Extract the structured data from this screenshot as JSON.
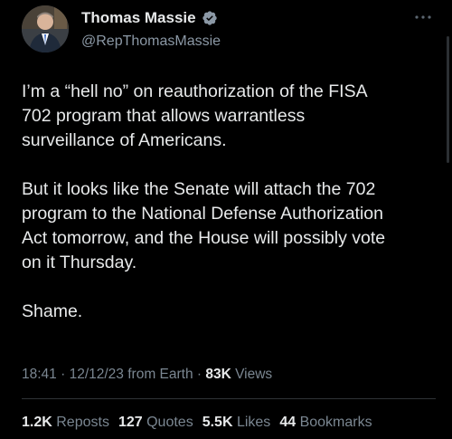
{
  "author": {
    "display_name": "Thomas Massie",
    "handle": "@RepThomasMassie",
    "verified_color": "#8b98a5",
    "avatar_icon": "portrait-avatar"
  },
  "tweet": {
    "paragraphs": [
      "I’m a “hell no” on reauthorization of the FISA\n702 program that allows warrantless\nsurveillance of Americans.",
      "But it looks like the Senate will attach the 702\nprogram to the National Defense Authorization\nAct tomorrow, and the House will possibly vote\non it Thursday.",
      "Shame."
    ]
  },
  "meta": {
    "time": "18:41",
    "separator1": " · ",
    "date": "12/12/23",
    "source": " from Earth",
    "separator2": " · ",
    "views_count": "83K",
    "views_label": " Views"
  },
  "stats": [
    {
      "count": "1.2K",
      "label": "Reposts"
    },
    {
      "count": "127",
      "label": "Quotes"
    },
    {
      "count": "5.5K",
      "label": "Likes"
    },
    {
      "count": "44",
      "label": "Bookmarks"
    }
  ],
  "colors": {
    "background": "#000000",
    "text_primary": "#e7e9ea",
    "text_secondary": "#7b8792"
  }
}
